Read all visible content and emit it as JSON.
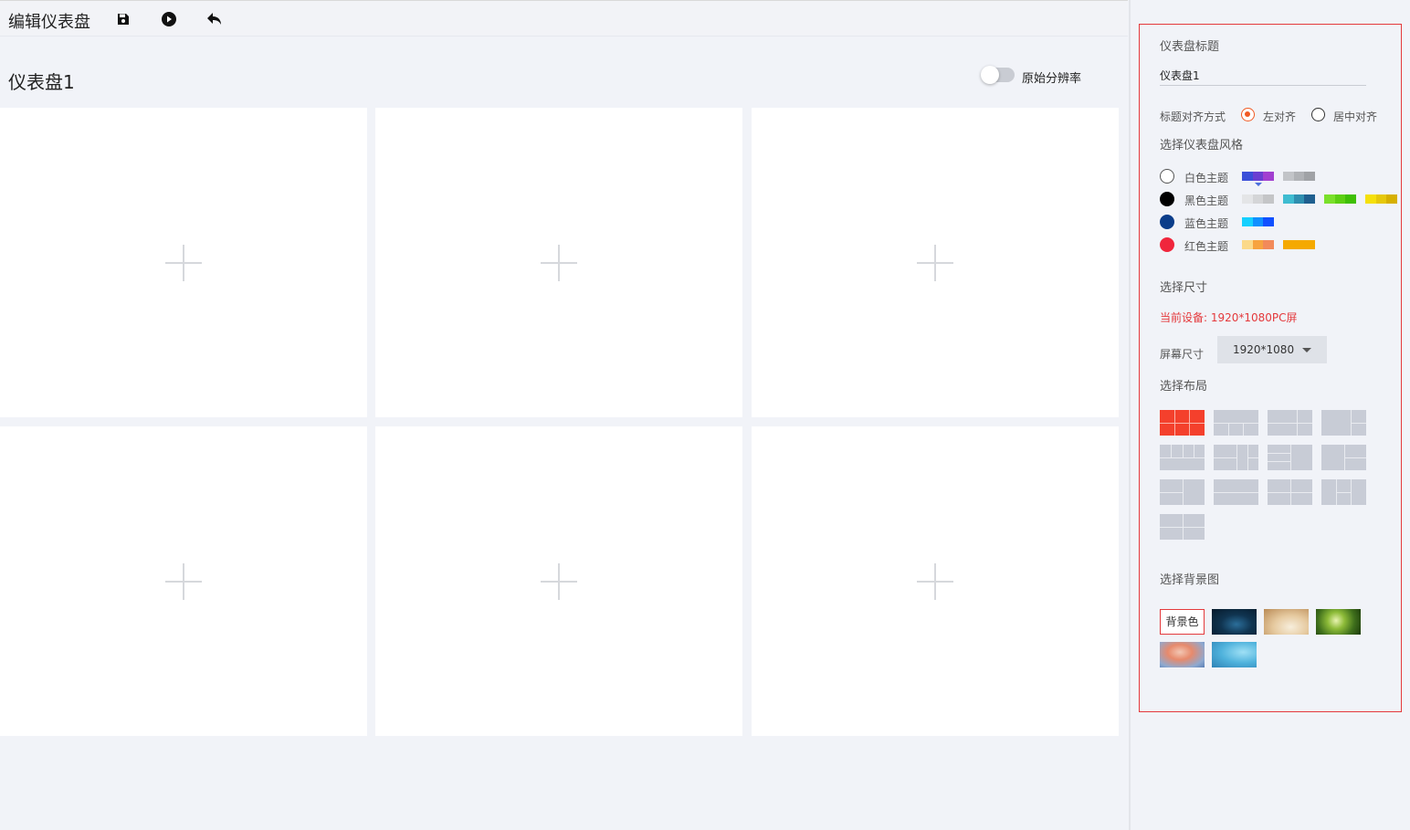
{
  "toolbar": {
    "title": "编辑仪表盘",
    "icons": [
      "save-icon",
      "play-icon",
      "undo-icon"
    ]
  },
  "dashboard": {
    "title": "仪表盘1",
    "toggle_label": "原始分辨率",
    "toggle_on": false,
    "panels": [
      "add-icon",
      "add-icon",
      "add-icon",
      "add-icon",
      "add-icon",
      "add-icon"
    ]
  },
  "settings": {
    "title_label": "仪表盘标题",
    "title_value": "仪表盘1",
    "align_label": "标题对齐方式",
    "align_options": [
      "左对齐",
      "居中对齐"
    ],
    "align_selected": "左对齐",
    "style_label": "选择仪表盘风格",
    "themes": [
      {
        "name": "白色主题",
        "dot": "#ffffff",
        "selected": true,
        "palettes": [
          [
            "#3b4fd8",
            "#6a3fd1",
            "#a23fd0"
          ],
          [
            "#c2c4c8",
            "#b0b2b6",
            "#a0a2a6"
          ]
        ]
      },
      {
        "name": "黑色主题",
        "dot": "#000000",
        "selected": false,
        "palettes": [
          [
            "#e4e5e7",
            "#d4d5d7",
            "#c4c5c7"
          ],
          [
            "#3fbcd1",
            "#2f8fb0",
            "#1f5f8f"
          ],
          [
            "#7ae02a",
            "#5ccf12",
            "#3fbf05"
          ],
          [
            "#f5e00a",
            "#e6c80a",
            "#d6b000"
          ]
        ]
      },
      {
        "name": "蓝色主题",
        "dot": "#0b3d8a",
        "selected": false,
        "palettes": [
          [
            "#15d0ff",
            "#1090ff",
            "#1050ff"
          ]
        ]
      },
      {
        "name": "红色主题",
        "dot": "#f0263c",
        "selected": false,
        "palettes": [
          [
            "#fbd98a",
            "#f7a340",
            "#f28a5a"
          ],
          [
            "#f5a900",
            "#f5a900",
            "#f5a900"
          ]
        ]
      }
    ],
    "size_label": "选择尺寸",
    "device": "当前设备: 1920*1080PC屏",
    "screen_label": "屏幕尺寸",
    "screen_value": "1920*1080",
    "layout_label": "选择布局",
    "layout_count": 13,
    "layout_selected": 0,
    "bg_label": "选择背景图",
    "bg_color_label": "背景色",
    "bg_images": [
      "dark-blue-space",
      "warm-beige-blur",
      "green-forest",
      "orange-blue-gradient",
      "sky-blue-gradient"
    ]
  }
}
